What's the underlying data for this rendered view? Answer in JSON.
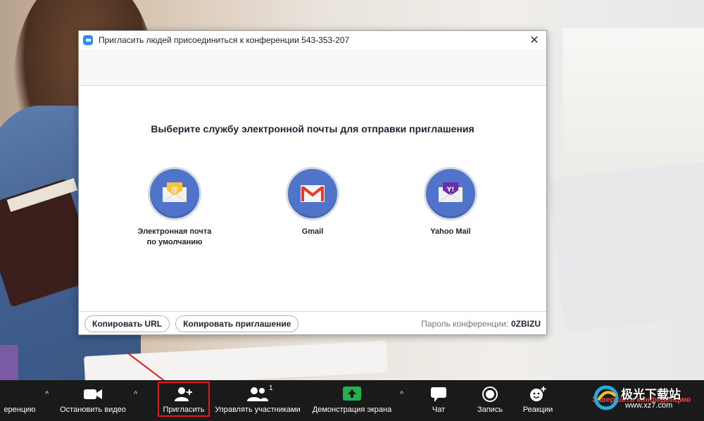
{
  "dialog": {
    "title": "Пригласить людей присоединиться к конференции 543-353-207",
    "close_glyph": "✕",
    "heading": "Выберите службу электронной почты для отправки приглашения",
    "services": [
      {
        "label_line1": "Электронная почта",
        "label_line2": "по умолчанию",
        "icon": "default-email-icon"
      },
      {
        "label_line1": "Gmail",
        "label_line2": "",
        "icon": "gmail-icon"
      },
      {
        "label_line1": "Yahoo Mail",
        "label_line2": "",
        "icon": "yahoo-mail-icon"
      }
    ],
    "copy_url_label": "Копировать URL",
    "copy_invite_label": "Копировать приглашение",
    "password_label": "Пароль конференции:",
    "password_value": "0ZBIZU"
  },
  "toolbar": {
    "audio_label": "еренцию",
    "video_label": "Остановить видео",
    "invite_label": "Пригласить",
    "participants_label": "Управлять участниками",
    "participants_count": "1",
    "share_label": "Демонстрация экрана",
    "chat_label": "Чат",
    "record_label": "Запись",
    "reactions_label": "Реакции",
    "end_label": "Завершить конференцию",
    "caret_glyph": "^"
  },
  "watermark": {
    "title": "极光下载站",
    "url": "www.xz7.com"
  },
  "colors": {
    "accent_blue": "#2d8cff",
    "service_circle": "#4f74c9",
    "share_green": "#22b14c",
    "highlight_red": "#e5161c",
    "end_red": "#ff3b30"
  }
}
